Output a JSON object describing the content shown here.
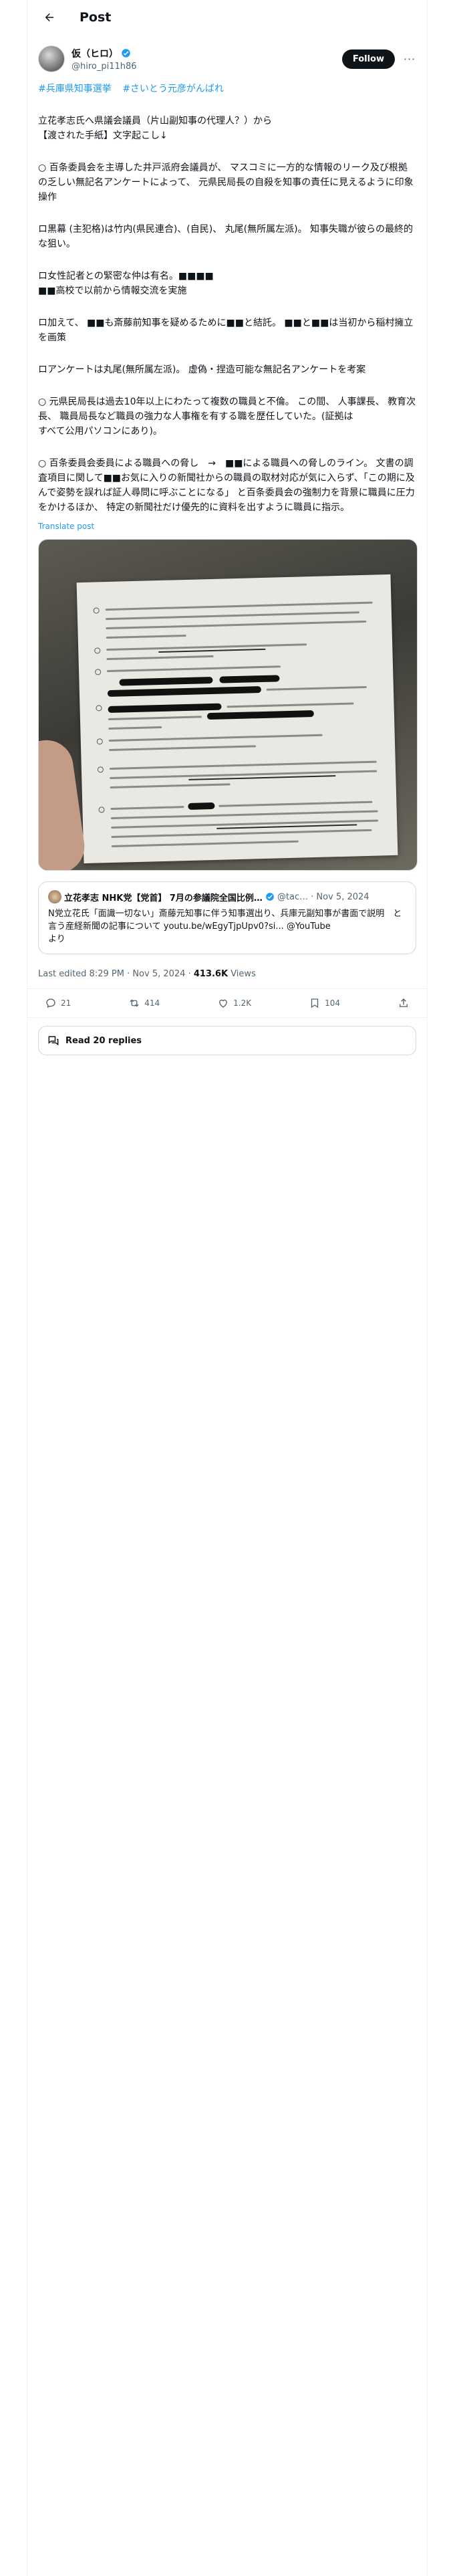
{
  "header": {
    "title": "Post"
  },
  "author": {
    "display_name": "仮（ヒロ）",
    "handle": "@hiro_pi11h86"
  },
  "buttons": {
    "follow": "Follow",
    "more": "···"
  },
  "tweet": {
    "hashtags": [
      "#兵庫県知事選挙",
      "#さいとう元彦がんばれ"
    ],
    "paragraphs": [
      "立花孝志氏へ県議会議員（片山副知事の代理人？）から\n【渡された手紙】文字起こし↓",
      "○ 百条委員会を主導した井戸派府会議員が、 マスコミに一方的な情報のリーク及び根拠の乏しい無記名アンケートによって、 元県民局長の自殺を知事の責任に見えるように印象操作",
      "ロ黒幕 (主犯格)は竹内(県民連合)、(自民)、 丸尾(無所属左派)。 知事失職が彼らの最終的な狙い。",
      "ロ女性記者との緊密な仲は有名。■■■■\n■■高校で以前から情報交流を実施",
      "ロ加えて、 ■■も斎藤前知事を疑めるために■■と結託。 ■■と■■は当初から稲村擁立を画策",
      "ロアンケートは丸尾(無所属左派)。 虚偽・捏造可能な無記名アンケートを考案",
      "○ 元県民局長は過去10年以上にわたって複数の職員と不倫。 この間、 人事課長、 教育次長、 職員局長など職員の強力な人事権を有する職を歴任していた。(証拠は\nすべて公用パソコンにあり)。",
      "○ 百条委員会委員による職員への脅し　→　■■による職員への脅しのライン。 文書の調査項目に関して■■お気に入りの新聞社からの職員の取材対応が気に入らず、「この期に及んで姿勢を誤れば証人尋問に呼ぶことになる」 と百条委員会の強制力を背景に職員に圧力をかけるほか、 特定の新聞社だけ優先的に資料を出すように職員に指示。"
    ],
    "translate_label": "Translate post"
  },
  "quote": {
    "name": "立花孝志 NHK党【党首】 7月の参議院全国比例…",
    "handle": "@tac…",
    "date": "· Nov 5, 2024",
    "text": "N党立花氏「面識一切ない」斎藤元知事に伴う知事選出り、兵庫元副知事が書面で説明　と言う産経新聞の記事について ",
    "link": "youtu.be/wEgyTjpUpv0?si... @YouTube",
    "text_end": "より"
  },
  "meta": {
    "edited": "Last edited 8:29 PM · Nov 5, 2024 · ",
    "views_count": "413.6K",
    "views_label": " Views"
  },
  "actions": {
    "replies": "21",
    "reposts": "414",
    "likes": "1.2K",
    "bookmarks": "104"
  },
  "read_replies": "Read 20 replies"
}
